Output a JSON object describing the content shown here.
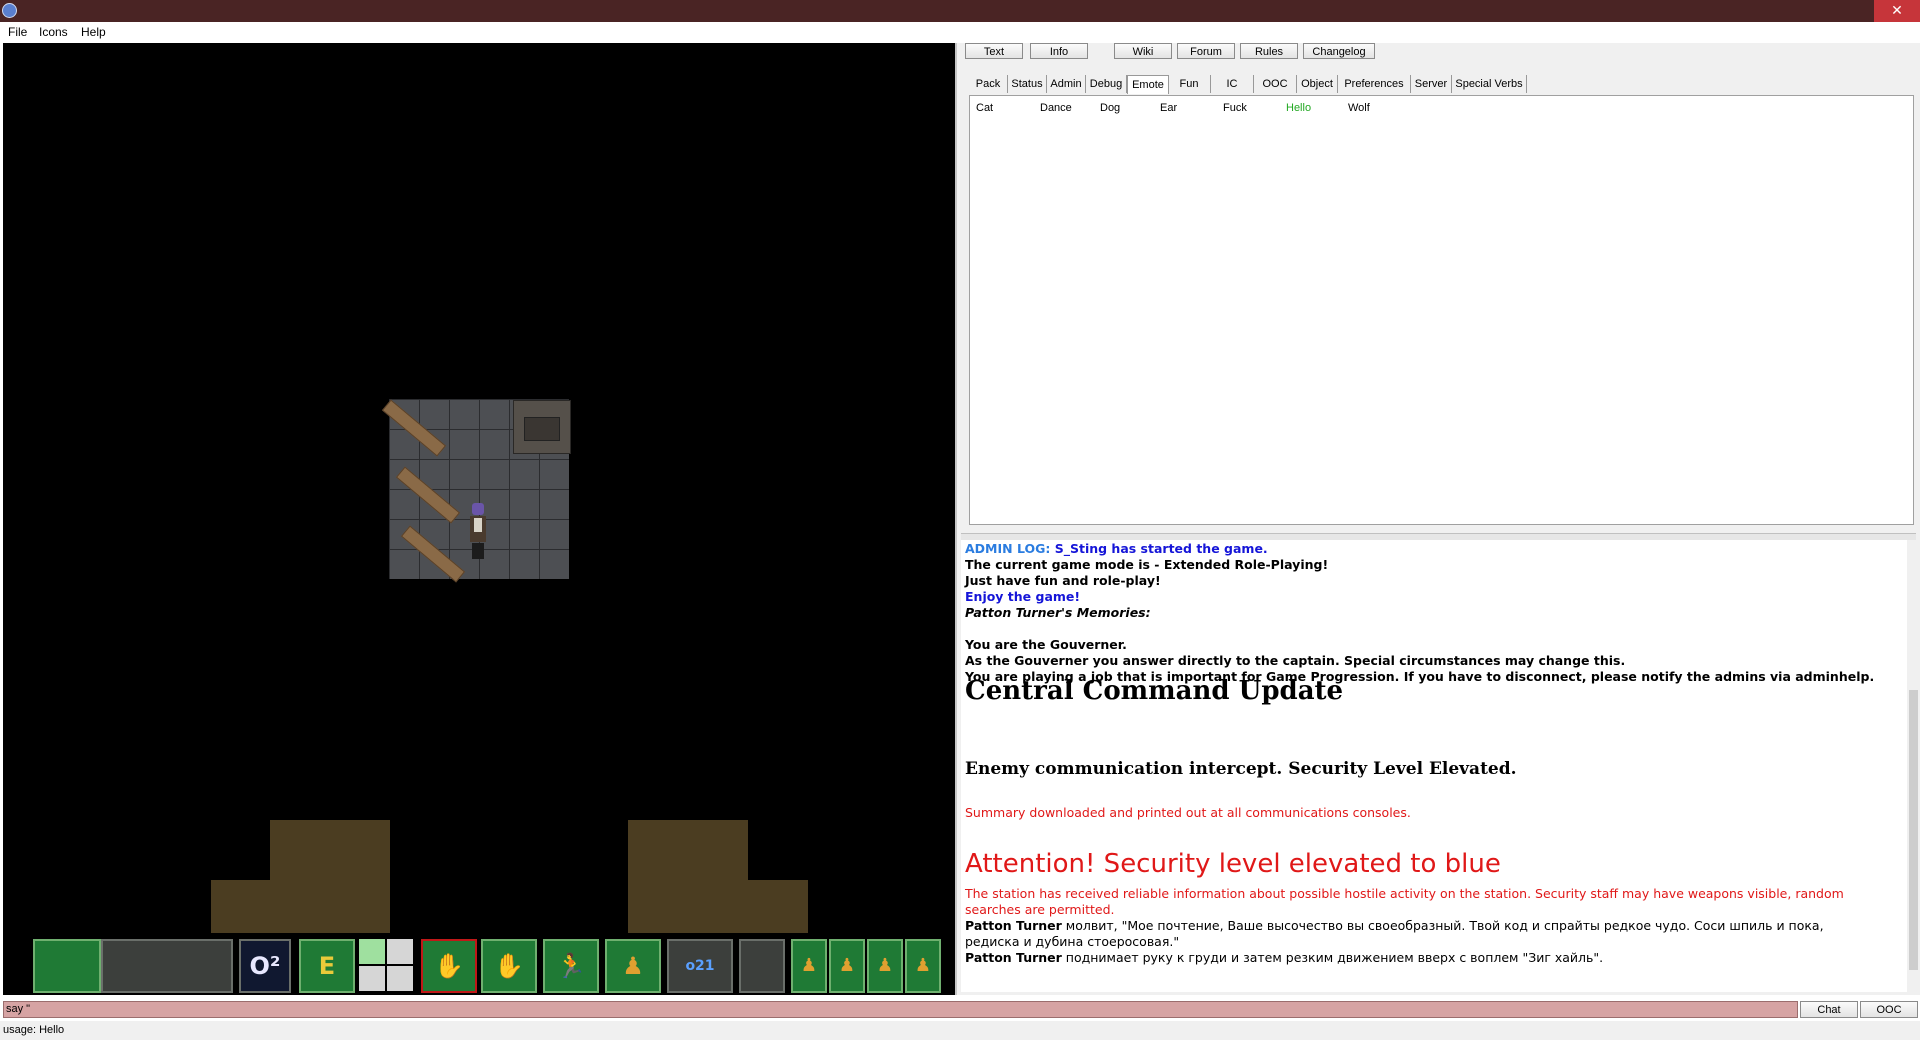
{
  "window": {
    "close_label": "✕"
  },
  "menu": [
    "File",
    "Icons",
    "Help"
  ],
  "top_buttons": [
    "Text",
    "Info",
    "Wiki",
    "Forum",
    "Rules",
    "Changelog"
  ],
  "tabs": [
    "Pack",
    "Status",
    "Admin",
    "Debug",
    "Emote",
    "Fun",
    "IC",
    "OOC",
    "Object",
    "Preferences",
    "Server",
    "Special Verbs"
  ],
  "active_tab": "Emote",
  "verbs": [
    "Cat",
    "Dance",
    "Dog",
    "Ear",
    "Fuck",
    "Hello",
    "Wolf"
  ],
  "active_verb": "Hello",
  "chat": {
    "admin_log_prefix": "ADMIN LOG:",
    "admin_log_text": "S_Sting has started the game.",
    "mode_line": "The current game mode is - Extended Role-Playing!",
    "fun_line": "Just have fun and role-play!",
    "enjoy_line": "Enjoy the game!",
    "memories_line": "Patton Turner's Memories:",
    "role_line": "You are the Gouverner.",
    "answer_line": "As the Gouverner you answer directly to the captain. Special circumstances may change this.",
    "job_line": "You are playing a job that is important for Game Progression. If you have to disconnect, please notify the admins via adminhelp.",
    "cc_title": "Central Command Update",
    "intercept_line": "Enemy communication intercept.  Security Level Elevated.",
    "summary_line": "Summary downloaded and printed out at all communications consoles.",
    "attention_title": "Attention! Security level elevated to blue",
    "attention_line1": "The station has received reliable information about possible hostile activity on the station. Security staff may have weapons visible, random",
    "attention_line2": "searches are permitted.",
    "say_name": "Patton Turner",
    "say_line1": " молвит, \"Мое почтение, Ваше высочество вы своеобразный. Твой код и спрайты редкое чудо. Соси шпиль и пока,",
    "say_line2": "редиска и дубина стоеросовая.\"",
    "emote_name": "Patton Turner",
    "emote_line": " поднимает руку к груди и затем резким движением вверх с воплем \"Зиг хайль\"."
  },
  "input": {
    "value": "say \""
  },
  "bottom_buttons": [
    "Chat",
    "OOC"
  ],
  "status": "usage: Hello",
  "hud": {
    "o2_label": "O²",
    "e_label": "E",
    "run_label": "🏃",
    "id_label": "o21"
  }
}
